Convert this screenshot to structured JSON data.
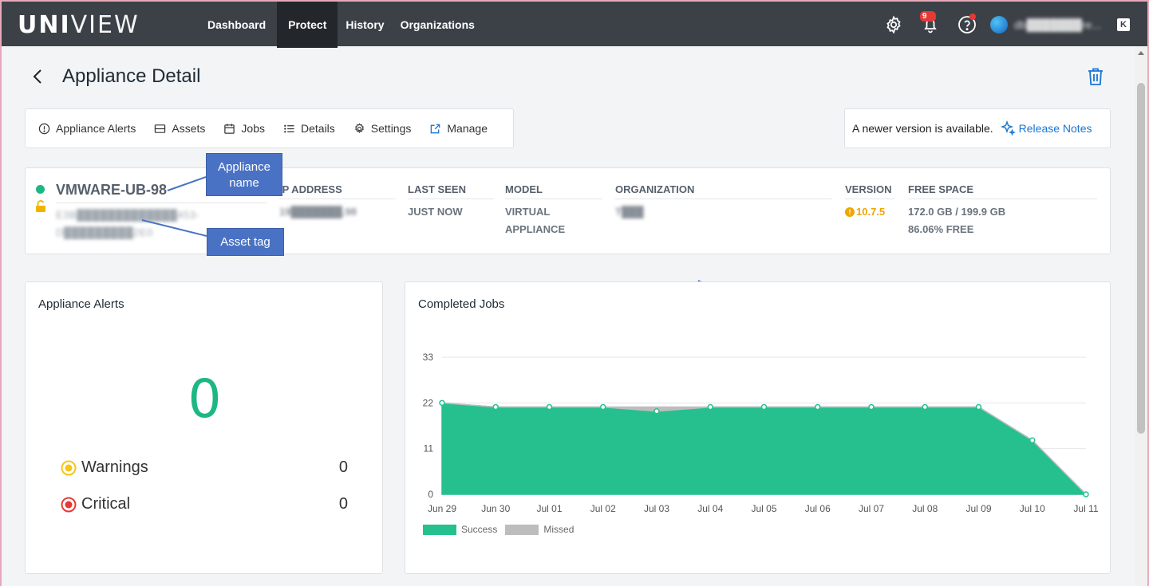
{
  "brand": {
    "logo_left": "UNI",
    "logo_right": "VIEW"
  },
  "nav": {
    "items": [
      "Dashboard",
      "Protect",
      "History",
      "Organizations"
    ],
    "active": "Protect"
  },
  "topbar": {
    "notification_count": "9",
    "user_name": "db███████re...",
    "ext_label": "K"
  },
  "page": {
    "title": "Appliance Detail"
  },
  "tabs": [
    "Appliance Alerts",
    "Assets",
    "Jobs",
    "Details",
    "Settings",
    "Manage"
  ],
  "version_notice": {
    "text": "A newer version is available.",
    "link": "Release Notes"
  },
  "summary": {
    "name": "VMWARE-UB-98",
    "asset_tag": "E3B█████████████453-D█████████2E0",
    "ip_header": "IP ADDRESS",
    "ip_value": "19███████.98",
    "last_seen_header": "LAST SEEN",
    "last_seen_value": "JUST NOW",
    "model_header": "MODEL",
    "model_value_1": "VIRTUAL",
    "model_value_2": "APPLIANCE",
    "org_header": "ORGANIZATION",
    "org_value": "T███",
    "version_header": "VERSION",
    "version_value": "10.7.5",
    "free_header": "FREE SPACE",
    "free_value": "172.0 GB / 199.9 GB",
    "free_pct": "86.06% FREE"
  },
  "callouts": {
    "appliance_name": "Appliance name",
    "asset_tag": "Asset tag"
  },
  "alerts": {
    "title": "Appliance Alerts",
    "total": "0",
    "warnings_label": "Warnings",
    "warnings_count": "0",
    "critical_label": "Critical",
    "critical_count": "0",
    "warning_color": "#f5c518",
    "critical_color": "#e53935"
  },
  "chart_data": {
    "type": "area",
    "title": "Completed Jobs",
    "x": [
      "Jun 29",
      "Jun 30",
      "Jul 01",
      "Jul 02",
      "Jul 03",
      "Jul 04",
      "Jul 05",
      "Jul 06",
      "Jul 07",
      "Jul 08",
      "Jul 09",
      "Jul 10",
      "Jul 11"
    ],
    "ylim": [
      0,
      33
    ],
    "yticks": [
      0,
      11,
      22,
      33
    ],
    "stacked": true,
    "grid": true,
    "legend_position": "bottom-left",
    "series": [
      {
        "name": "Success",
        "color": "#26c08f",
        "values": [
          22,
          21,
          21,
          21,
          20,
          21,
          21,
          21,
          21,
          21,
          21,
          13,
          0
        ]
      },
      {
        "name": "Missed",
        "color": "#bdbdbd",
        "values": [
          0,
          0,
          0,
          0,
          1,
          0,
          0,
          0,
          0,
          0,
          0,
          0,
          0
        ]
      }
    ]
  }
}
